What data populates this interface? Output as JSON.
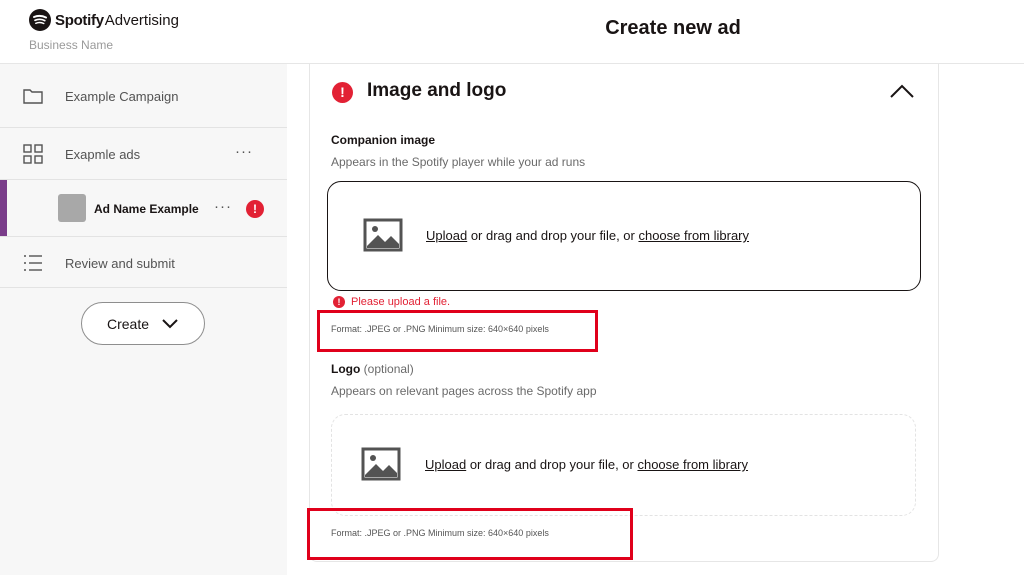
{
  "header": {
    "brand_name": "Spotify",
    "brand_sub": "Advertising",
    "business_name": "Business Name",
    "page_title": "Create new ad"
  },
  "sidebar": {
    "campaign_label": "Example Campaign",
    "ads_label": "Exapmle ads",
    "ad_name": "Ad Name Example",
    "review_label": "Review and submit",
    "more_glyph": "···",
    "error_glyph": "!",
    "create_label": "Create"
  },
  "section": {
    "title": "Image and logo",
    "error_glyph": "!",
    "companion": {
      "title": "Companion image",
      "desc": "Appears in the Spotify player while your ad runs",
      "upload": "Upload",
      "middle": " or drag and drop your file, or ",
      "library": "choose from library",
      "error": "Please upload a file.",
      "format": "Format: .JPEG or .PNG Minimum size: 640×640 pixels"
    },
    "logo": {
      "title": "Logo",
      "optional": "(optional)",
      "desc": "Appears on relevant pages across the Spotify app",
      "upload": "Upload",
      "middle": " or drag and drop your file, or ",
      "library": "choose from library",
      "format": "Format: .JPEG or .PNG Minimum size: 640×640 pixels"
    }
  },
  "colors": {
    "accent": "#7a3d8a",
    "error": "#e22134",
    "highlight": "#e0001b"
  }
}
